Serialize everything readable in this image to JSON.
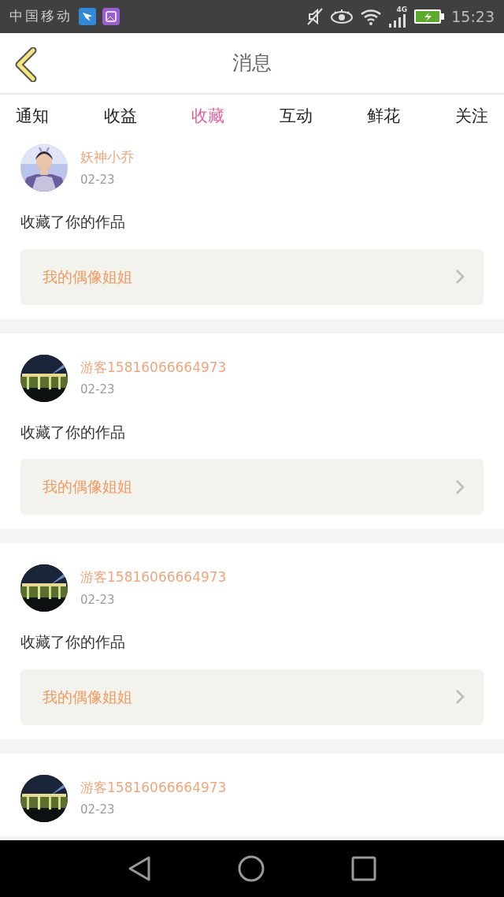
{
  "status_bar": {
    "carrier": "中国移动",
    "network": "4G",
    "time": "15:23"
  },
  "header": {
    "title": "消息"
  },
  "tabs": [
    {
      "label": "通知",
      "selected": false
    },
    {
      "label": "收益",
      "selected": false
    },
    {
      "label": "收藏",
      "selected": true
    },
    {
      "label": "互动",
      "selected": false
    },
    {
      "label": "鲜花",
      "selected": false
    },
    {
      "label": "关注",
      "selected": false
    }
  ],
  "messages": [
    {
      "user": "妖神小乔",
      "date": "02-23",
      "text": "收藏了你的作品",
      "work": "我的偶像姐姐"
    },
    {
      "user": "游客15816066664973",
      "date": "02-23",
      "text": "收藏了你的作品",
      "work": "我的偶像姐姐"
    },
    {
      "user": "游客15816066664973",
      "date": "02-23",
      "text": "收藏了你的作品",
      "work": "我的偶像姐姐"
    },
    {
      "user": "游客15816066664973",
      "date": "02-23"
    }
  ]
}
